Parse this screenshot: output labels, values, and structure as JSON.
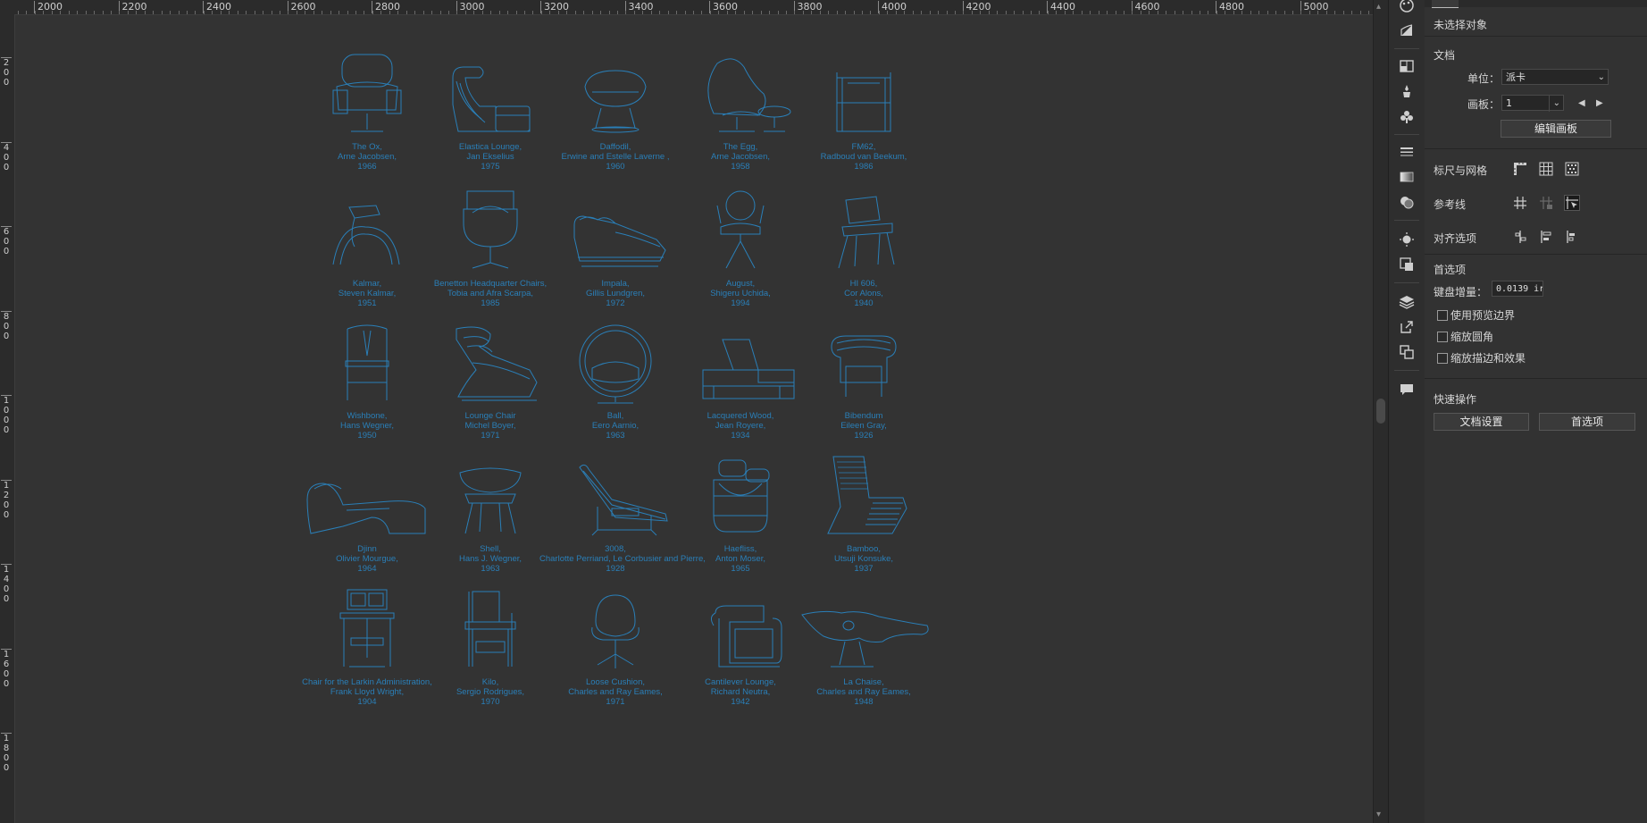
{
  "ruler": {
    "top_labels": [
      "2000",
      "2200",
      "2400",
      "2600",
      "2800",
      "3000",
      "3200",
      "3400",
      "3600",
      "3800",
      "4000",
      "4200",
      "4400",
      "4600",
      "4800",
      "5000"
    ],
    "left_labels": [
      [
        "2",
        "0",
        "0"
      ],
      [
        "4",
        "0",
        "0"
      ],
      [
        "6",
        "0",
        "0"
      ],
      [
        "8",
        "0",
        "0"
      ],
      [
        "1",
        "0",
        "0",
        "0"
      ],
      [
        "1",
        "2",
        "0",
        "0"
      ],
      [
        "1",
        "4",
        "0",
        "0"
      ],
      [
        "1",
        "6",
        "0",
        "0"
      ],
      [
        "1",
        "8",
        "0",
        "0"
      ]
    ]
  },
  "chairs": [
    {
      "icon": "the-ox-chair-icon",
      "lines": [
        "The Ox,",
        "Arne Jacobsen,",
        "1966"
      ]
    },
    {
      "icon": "elastica-lounge-chair-icon",
      "lines": [
        "Elastica Lounge,",
        "Jan Ekselius",
        "1975"
      ]
    },
    {
      "icon": "daffodil-chair-icon",
      "lines": [
        "Daffodil,",
        "Erwine and Estelle Laverne ,",
        "1960"
      ]
    },
    {
      "icon": "the-egg-chair-icon",
      "lines": [
        "The Egg,",
        "Arne Jacobsen,",
        "1958"
      ]
    },
    {
      "icon": "fm62-chair-icon",
      "lines": [
        "FM62,",
        "Radboud van Beekum,",
        "1986"
      ]
    },
    {
      "icon": "kalmar-chair-icon",
      "lines": [
        "Kalmar,",
        "Steven Kalmar,",
        "1951"
      ]
    },
    {
      "icon": "benetton-chair-icon",
      "lines": [
        "Benetton Headquarter Chairs,",
        "Tobia and Afra Scarpa,",
        "1985"
      ]
    },
    {
      "icon": "impala-chair-icon",
      "lines": [
        "Impala,",
        "Gillis Lundgren,",
        "1972"
      ]
    },
    {
      "icon": "august-chair-icon",
      "lines": [
        "August,",
        "Shigeru Uchida,",
        "1994"
      ]
    },
    {
      "icon": "hi606-chair-icon",
      "lines": [
        "HI 606,",
        "Cor Alons,",
        "1940"
      ]
    },
    {
      "icon": "wishbone-chair-icon",
      "lines": [
        "Wishbone,",
        "Hans Wegner,",
        "1950"
      ]
    },
    {
      "icon": "lounge-chair-icon",
      "lines": [
        "Lounge Chair",
        "Michel Boyer,",
        "1971"
      ]
    },
    {
      "icon": "ball-chair-icon",
      "lines": [
        "Ball,",
        "Eero Aarnio,",
        "1963"
      ]
    },
    {
      "icon": "lacquered-wood-chair-icon",
      "lines": [
        "Lacquered Wood,",
        "Jean Royere,",
        "1934"
      ]
    },
    {
      "icon": "bibendum-chair-icon",
      "lines": [
        "Bibendum",
        "Eileen Gray,",
        "1926"
      ]
    },
    {
      "icon": "djinn-chair-icon",
      "lines": [
        "Djinn",
        "Olivier Mourgue,",
        "1964"
      ]
    },
    {
      "icon": "shell-chair-icon",
      "lines": [
        "Shell,",
        "Hans J. Wegner,",
        "1963"
      ]
    },
    {
      "icon": "lc4-chair-icon",
      "lines": [
        "3008,",
        "Charlotte Perriand, Le Corbusier and Pierre,",
        "1928"
      ]
    },
    {
      "icon": "haefliss-chair-icon",
      "lines": [
        "Haefliss,",
        "Anton Moser,",
        "1965"
      ]
    },
    {
      "icon": "bamboo-chair-icon",
      "lines": [
        "Bamboo,",
        "Utsuji Konsuke,",
        "1937"
      ]
    },
    {
      "icon": "larkin-chair-icon",
      "lines": [
        "Chair for the Larkin Administration,",
        "Frank Lloyd Wright,",
        "1904"
      ]
    },
    {
      "icon": "kilo-chair-icon",
      "lines": [
        "Kilo,",
        "Sergio Rodrigues,",
        "1970"
      ]
    },
    {
      "icon": "loose-cushion-chair-icon",
      "lines": [
        "Loose Cushion,",
        "Charles and Ray Eames,",
        "1971"
      ]
    },
    {
      "icon": "cantilever-lounge-chair-icon",
      "lines": [
        "Cantilever Lounge,",
        "Richard Neutra,",
        "1942"
      ]
    },
    {
      "icon": "la-chaise-chair-icon",
      "lines": [
        "La Chaise,",
        "Charles and Ray Eames,",
        "1948"
      ]
    }
  ],
  "panel": {
    "no_selection": "未选择对象",
    "document_heading": "文档",
    "unit_label": "单位：",
    "unit_value": "派卡",
    "artboard_label": "画板：",
    "artboard_value": "1",
    "edit_artboards": "编辑画板",
    "rulers_grids": "标尺与网格",
    "guides": "参考线",
    "align_options": "对齐选项",
    "preferences_heading": "首选项",
    "keyboard_increment_label": "键盘增量：",
    "keyboard_increment_value": "0.0139 ir",
    "use_preview_bounds": "使用预览边界",
    "scale_corners": "缩放圆角",
    "scale_strokes_effects": "缩放描边和效果",
    "quick_actions": "快速操作",
    "doc_setup_button": "文档设置",
    "preferences_button": "首选项"
  },
  "colors": {
    "line_art": "#2a7fb8",
    "canvas": "#333333",
    "panel": "#323232"
  }
}
